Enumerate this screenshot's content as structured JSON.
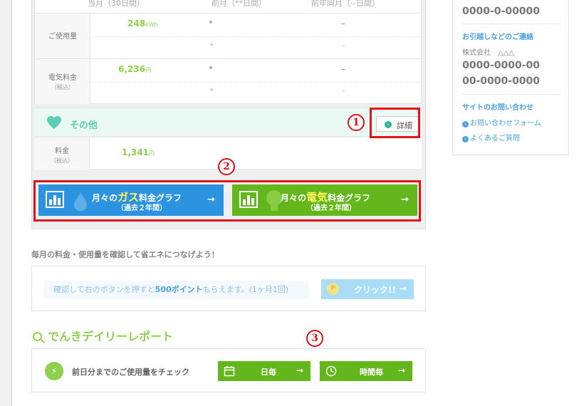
{
  "usage": {
    "headers": [
      "当月（30日間）",
      "前月（**日間）",
      "前年同月（--日間）"
    ],
    "rows": [
      {
        "label": "ご使用量",
        "sublabel": "",
        "value": "248",
        "unit": "kWh",
        "prev": "*",
        "prev_sub": "*",
        "year": "–",
        "year_sub": "–"
      },
      {
        "label": "電気料金",
        "sublabel": "（税込）",
        "value": "6,236",
        "unit": "円",
        "prev": "*",
        "prev_sub": "*",
        "year": "–",
        "year_sub": "–"
      }
    ]
  },
  "other": {
    "title": "その他",
    "detail_label": "詳細",
    "row_label": "料金",
    "row_sublabel": "（税込）",
    "value": "1,341",
    "unit": "円",
    "icon": "heart-icon"
  },
  "graphs": {
    "gas": {
      "prefix": "月々の",
      "highlight": "ガス",
      "suffix": "料金グラフ",
      "sub": "（過去２年間）",
      "arrow": "→"
    },
    "electric": {
      "prefix": "月々の",
      "highlight": "電気",
      "suffix": "料金グラフ",
      "sub": "（過去２年間）",
      "arrow": "→"
    }
  },
  "annotations": [
    "1",
    "2",
    "3"
  ],
  "points": {
    "title": "毎月の料金・使用量を確認して省エネにつなげよう！",
    "msg_before": "確認して右のボタンを押すと",
    "msg_bold": "500ポイント",
    "msg_after": "もらえます。(1ヶ月1回)",
    "button": "クリック!!",
    "coin": "P",
    "arrow": "→"
  },
  "daily": {
    "title": "でんきデイリーレポート",
    "message": "前日分までのご使用量をチェック",
    "day_button": "日毎",
    "hour_button": "時間毎",
    "arrow": "→"
  },
  "sidebar": {
    "top_number": "0000-0-00000",
    "move_heading": "お引越しなどのご連絡",
    "company": "株式会社　△△△",
    "phone1": "0000-0000-00",
    "phone2": "00-0000-0000",
    "contact_heading": "サイトのお問い合わせ",
    "links": [
      "お問い合わせフォーム",
      "よくあるご質問"
    ]
  },
  "colors": {
    "green": "#8fd14f",
    "blue": "#2c93e0",
    "button_green": "#63b71c",
    "red": "#e2141b",
    "teal": "#5fcdb4"
  }
}
